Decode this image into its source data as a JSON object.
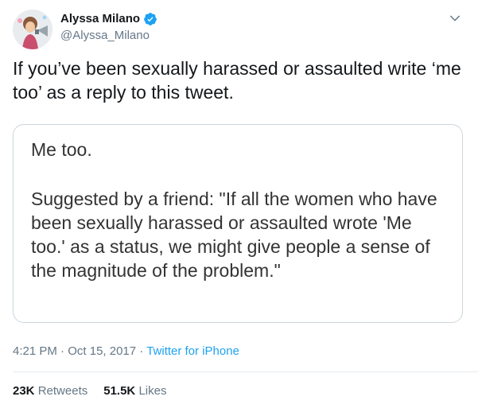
{
  "author": {
    "display_name": "Alyssa Milano",
    "handle": "@Alyssa_Milano",
    "verified_icon": "verified-badge-icon",
    "avatar": "avatar"
  },
  "tweet": {
    "text": "If you’ve been sexually harassed or assaulted write ‘me too’ as a reply to this tweet."
  },
  "media": {
    "line1": "Me too.",
    "line2": "Suggested by a friend: \"If all the women who have been sexually harassed or assaulted wrote 'Me too.' as a status, we might give people a sense of the magnitude of the problem.\""
  },
  "meta": {
    "time": "4:21 PM",
    "sep1": " · ",
    "date": "Oct 15, 2017",
    "sep2": " · ",
    "source": "Twitter for iPhone"
  },
  "stats": {
    "retweets_count": "23K",
    "retweets_label": "Retweets",
    "likes_count": "51.5K",
    "likes_label": "Likes"
  },
  "colors": {
    "accent": "#1da1f2",
    "muted": "#657786",
    "text": "#14171a",
    "border": "#ccd6dd"
  }
}
